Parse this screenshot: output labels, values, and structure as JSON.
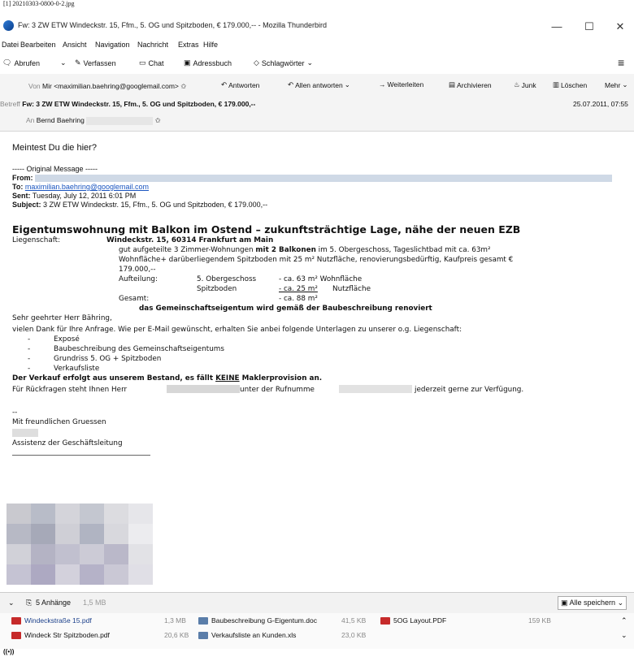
{
  "caption": "[1] 20210303-0800-0-2.jpg",
  "window": {
    "title": "Fw: 3 ZW ETW Windeckstr. 15, Ffm., 5. OG und Spitzboden, € 179.000,-- - Mozilla Thunderbird",
    "min": "—",
    "max": "☐",
    "close": "✕"
  },
  "menu": [
    "Datei",
    "Bearbeiten",
    "Ansicht",
    "Navigation",
    "Nachricht",
    "Extras",
    "Hilfe"
  ],
  "toolbar": {
    "get": "Abrufen",
    "compose": "Verfassen",
    "chat": "Chat",
    "addressbook": "Adressbuch",
    "tags": "Schlagwörter",
    "menu": "≡"
  },
  "header": {
    "from_label": "Von",
    "from_value": "Mir <maximilian.baehring@googlemail.com>",
    "reply": "Antworten",
    "reply_all": "Allen antworten",
    "forward": "Weiterleiten",
    "archive": "Archivieren",
    "junk": "Junk",
    "delete": "Löschen",
    "more": "Mehr",
    "subject_label": "Betreff",
    "subject_value": "Fw: 3 ZW ETW Windeckstr. 15, Ffm., 5. OG und Spitzboden, € 179.000,--",
    "date": "25.07.2011, 07:55",
    "to_label": "An",
    "to_value": "Bernd Baehring"
  },
  "body": {
    "greeting": "Meintest Du die hier?",
    "orig": "----- Original Message -----",
    "from": "From:",
    "to_label": "To:",
    "to_value": "maximilian.baehring@googlemail.com",
    "sent_label": "Sent:",
    "sent_value": "Tuesday, July 12, 2011 6:01 PM",
    "subj_label": "Subject:",
    "subj_value": "3 ZW ETW Windeckstr. 15, Ffm., 5. OG und Spitzboden, € 179.000,--",
    "headline": "Eigentumswohnung mit Balkon im Ostend – zukunftsträchtige Lage, nähe der neuen EZB",
    "lieg_label": "Liegenschaft:",
    "lieg_value": "Windeckstr. 15, 60314 Frankfurt am Main",
    "desc1a": "gut aufgeteilte 3 Zimmer-Wohnungen ",
    "desc1b": "mit 2 Balkonen",
    "desc1c": " im 5. Obergeschoss, Tageslichtbad mit ca. 63m²",
    "desc2": "Wohnfläche+ darüberliegendem Spitzboden mit 25 m² Nutzfläche, renovierungsbedürftig, Kaufpreis gesamt €",
    "desc3": "179.000,--",
    "auf_label": "Aufteilung:",
    "og": "5. Obergeschoss",
    "og_val": "- ca. 63 m² Wohnfläche",
    "spitz": "Spitzboden",
    "spitz_val": "- ca. 25 m²",
    "spitz_unit": "Nutzfläche",
    "ges_label": "Gesamt:",
    "ges_val": "- ca. 88 m²",
    "gemein": "das Gemeinschaftseigentum wird gemäß der Baubeschreibung renoviert",
    "dear": "Sehr geehrter Herr Bähring,",
    "thanks": "vielen Dank für Ihre Anfrage. Wie per E-Mail gewünscht, erhalten Sie anbei folgende Unterlagen zu unserer o.g. Liegenschaft:",
    "items": [
      "Exposé",
      "Baubeschreibung des Gemeinschaftseigentums",
      "Grundriss 5. OG + Spitzboden",
      "Verkaufsliste"
    ],
    "verkauf_a": "Der Verkauf erfolgt aus unserem Bestand, es fällt ",
    "verkauf_b": "KEINE",
    "verkauf_c": " Maklerprovision an.",
    "rueck_a": "Für Rückfragen steht Ihnen Herr",
    "rueck_b": "unter der Rufnumme",
    "rueck_c": "jederzeit gerne zur Verfügung.",
    "sigdash": "--",
    "regards": "Mit freundlichen Gruessen",
    "assist": "Assistenz der Geschäftsleitung"
  },
  "attachments": {
    "count": "5 Anhänge",
    "size": "1,5 MB",
    "save_all": "Alle speichern",
    "files": [
      {
        "name": "Windeckstraße 15.pdf",
        "size": "1,3 MB",
        "type": "pdf"
      },
      {
        "name": "Baubeschreibung G-Eigentum.doc",
        "size": "41,5 KB",
        "type": "doc"
      },
      {
        "name": "5OG Layout.PDF",
        "size": "159 KB",
        "type": "pdf"
      },
      {
        "name": "Windeck Str Spitzboden.pdf",
        "size": "20,6 KB",
        "type": "pdf"
      },
      {
        "name": "Verkaufsliste an Kunden.xls",
        "size": "23,0 KB",
        "type": "xls"
      }
    ]
  },
  "status": "((•))"
}
